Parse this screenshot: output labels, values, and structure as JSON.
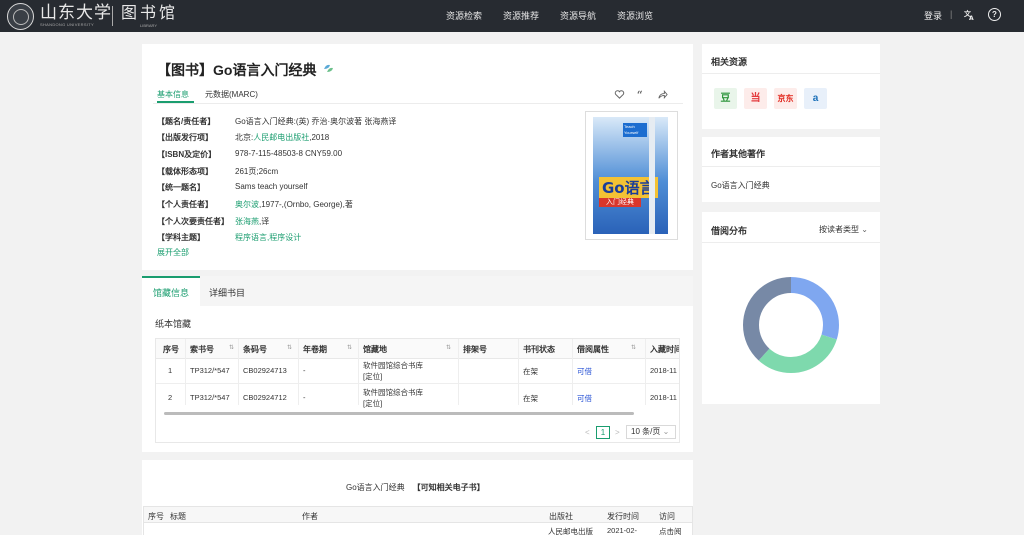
{
  "header": {
    "logo_text": "山东大学",
    "logo_sub": "SHANDONG UNIVERSITY",
    "library_text": "图书馆",
    "library_sub": "LIBRARY",
    "nav": [
      "资源检索",
      "资源推荐",
      "资源导航",
      "资源浏览"
    ],
    "login": "登录",
    "separator": "|",
    "lang_icon": "translate-icon",
    "help_icon": "help-icon",
    "help_glyph": "?"
  },
  "book": {
    "title": "【图书】Go语言入门经典",
    "tabs": [
      "基本信息",
      "元数据(MARC)"
    ],
    "actions": [
      "heart-icon",
      "quote-icon",
      "share-icon"
    ],
    "fields": [
      {
        "label": "【题名/责任者】",
        "value": "Go语言入门经典:(英) 乔治·奥尔波著 张海燕译"
      },
      {
        "label": "【出版发行项】",
        "prefix": "北京:",
        "link": "人民邮电出版社",
        "suffix": ",2018"
      },
      {
        "label": "【ISBN及定价】",
        "value": "978-7-115-48503-8 CNY59.00"
      },
      {
        "label": "【载体形态项】",
        "value": "261页;26cm"
      },
      {
        "label": "【统一题名】",
        "value": "Sams teach yourself"
      },
      {
        "label": "【个人责任者】",
        "link": "奥尔波",
        "suffix": ",1977-,(Ornbo, George),著"
      },
      {
        "label": "【个人次要责任者】",
        "link": "张海燕",
        "suffix": ",译"
      },
      {
        "label": "【学科主题】",
        "link": "程序语言",
        "sep": ",",
        "link2": "程序设计"
      }
    ],
    "expand_all": "展开全部",
    "cover": {
      "go": "Go语言",
      "band": "入门经典",
      "teach": "Teach Yourself"
    }
  },
  "holdings": {
    "tabs": [
      "馆藏信息",
      "详细书目"
    ],
    "section_title": "纸本馆藏",
    "columns": [
      "序号",
      "索书号",
      "条码号",
      "年卷期",
      "馆藏地",
      "排架号",
      "书刊状态",
      "借阅属性",
      "入藏时间"
    ],
    "rows": [
      {
        "no": "1",
        "call": "TP312/*547",
        "barcode": "CB02924713",
        "vol": "-",
        "location": "软件园馆综合书库",
        "locate": "[定位]",
        "shelf": "",
        "status": "在架",
        "borrow": "可借",
        "date": "2018-11"
      },
      {
        "no": "2",
        "call": "TP312/*547",
        "barcode": "CB02924712",
        "vol": "-",
        "location": "软件园馆综合书库",
        "locate": "[定位]",
        "shelf": "",
        "status": "在架",
        "borrow": "可借",
        "date": "2018-11"
      }
    ],
    "pager": {
      "prev": "<",
      "page": "1",
      "next": ">",
      "size": "10 条/页"
    }
  },
  "ebook": {
    "title": "Go语言入门经典",
    "tag": "【可知相关电子书】",
    "columns": [
      "序号",
      "标题",
      "作者",
      "出版社",
      "发行时间",
      "访问"
    ],
    "row": {
      "publisher": "人民邮电出版",
      "date": "2021-02-",
      "visit": "点击阅"
    }
  },
  "sidebar": {
    "related_title": "相关资源",
    "related": [
      {
        "icon": "douban-icon",
        "glyph": "豆",
        "color": "#2e963d",
        "bg": "#e9f5ea"
      },
      {
        "icon": "dangdang-icon",
        "glyph": "当",
        "color": "#e4393c",
        "bg": "#fdecea"
      },
      {
        "icon": "jd-icon",
        "glyph": "京东",
        "color": "#e1251b",
        "bg": "#fdecea"
      },
      {
        "icon": "amazon-icon",
        "glyph": "a",
        "color": "#1a6fb8",
        "bg": "#e8f0fa"
      }
    ],
    "other_works_title": "作者其他著作",
    "other_works": [
      "Go语言入门经典"
    ],
    "borrow_title": "借阅分布",
    "borrow_filter": "按读者类型",
    "colors": {
      "blue": "#7fa7f0",
      "green": "#7ed9ad",
      "slate": "#7789a6"
    }
  }
}
